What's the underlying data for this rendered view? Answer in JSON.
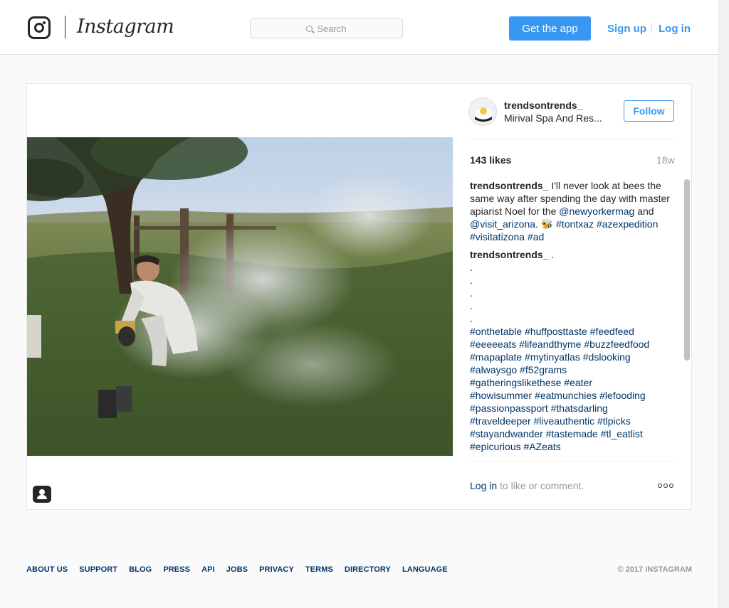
{
  "header": {
    "brand": "Instagram",
    "search_placeholder": "Search",
    "get_app": "Get the app",
    "sign_up": "Sign up",
    "log_in": "Log in"
  },
  "post": {
    "username": "trendsontrends_",
    "location": "Mirival Spa And Res...",
    "follow": "Follow",
    "likes": "143 likes",
    "age": "18w",
    "caption_user": "trendsontrends_",
    "caption_text": "I'll never look at bees the same way after spending the day with master apiarist Noel for the",
    "mention1": "@newyorkermag",
    "and_text": "and",
    "mention2": "@visit_arizona",
    "emoji": "🐝",
    "caption_tags": "#tontxaz #azexpedition #visitatizona #ad",
    "comment_user": "trendsontrends_",
    "comment_first": ".",
    "comment_dots": [
      ".",
      ".",
      ".",
      ".",
      "."
    ],
    "comment_tag_lines": [
      "#onthetable #huffposttaste #feedfeed",
      "#eeeeeats #lifeandthyme #buzzfeedfood",
      "#mapaplate #mytinyatlas #dslooking",
      "#alwaysgo #f52grams",
      "#gatheringslikethese #eater",
      "#howisummer #eatmunchies #lefooding",
      "#passionpassport #thatsdarling",
      "#traveldeeper #liveauthentic #tlpicks",
      "#stayandwander #tastemade #tl_eatlist",
      "#epicurious #AZeats"
    ],
    "login_link": "Log in",
    "login_suffix": "to like or comment."
  },
  "footer": {
    "links": [
      "ABOUT US",
      "SUPPORT",
      "BLOG",
      "PRESS",
      "API",
      "JOBS",
      "PRIVACY",
      "TERMS",
      "DIRECTORY",
      "LANGUAGE"
    ],
    "copyright": "© 2017 INSTAGRAM"
  }
}
